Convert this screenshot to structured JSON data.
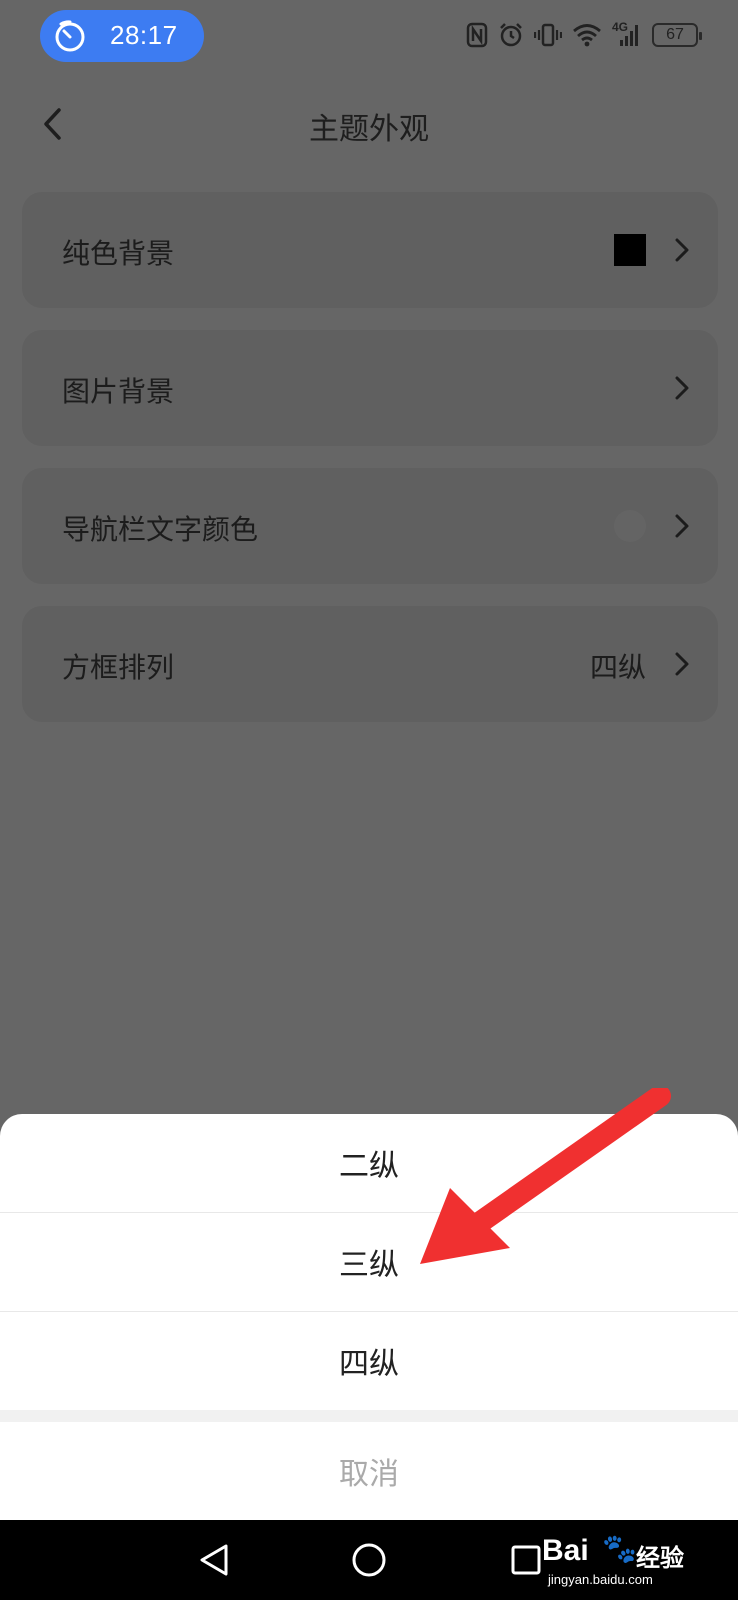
{
  "status_bar": {
    "timer": "28:17",
    "network_label": "4G",
    "battery": "67"
  },
  "header": {
    "title": "主题外观"
  },
  "settings": [
    {
      "label": "纯色背景",
      "value": "",
      "swatch": "#000000"
    },
    {
      "label": "图片背景",
      "value": ""
    },
    {
      "label": "导航栏文字颜色",
      "value": ""
    },
    {
      "label": "方框排列",
      "value": "四纵"
    }
  ],
  "sheet": {
    "options": [
      "二纵",
      "三纵",
      "四纵"
    ],
    "cancel": "取消"
  },
  "colors": {
    "overlay": "#666666",
    "timer_pill": "#3d7cf2",
    "annotation_arrow": "#f03030"
  },
  "watermark": {
    "brand": "Bai",
    "product": "经验",
    "url": "jingyan.baidu.com"
  }
}
